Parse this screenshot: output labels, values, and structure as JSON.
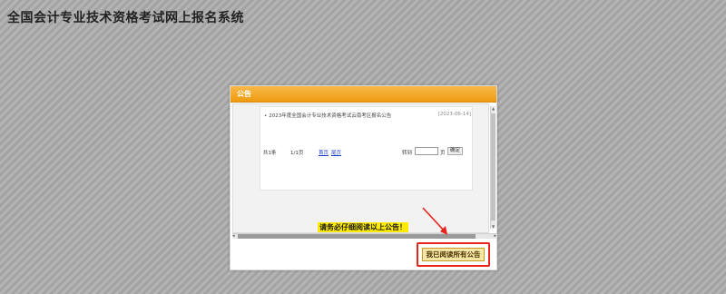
{
  "page": {
    "title": "全国会计专业技术资格考试网上报名系统"
  },
  "dialog": {
    "header": "公告",
    "notices": [
      {
        "bullet": "•",
        "title": "2023年度全国会计专业技术资格考试云南考区报名公告",
        "date": "[2023-06-14]"
      }
    ],
    "pager": {
      "total": "共1条",
      "pages": "1/1页",
      "first": "首页",
      "last": "尾页",
      "goto": "转到",
      "page_unit": "页",
      "confirm": "确定"
    },
    "warning": "请务必仔细阅读以上公告！",
    "read_all_button": "我已阅读所有公告"
  },
  "colors": {
    "header": "#ef9b10",
    "highlight_box": "#e8231a",
    "warning_bg": "#ffeb00"
  },
  "icons": {
    "scroll_up": "triangle-up",
    "scroll_down": "triangle-down",
    "scroll_left": "triangle-left",
    "scroll_right": "triangle-right",
    "annotation_arrow": "red-arrow"
  }
}
